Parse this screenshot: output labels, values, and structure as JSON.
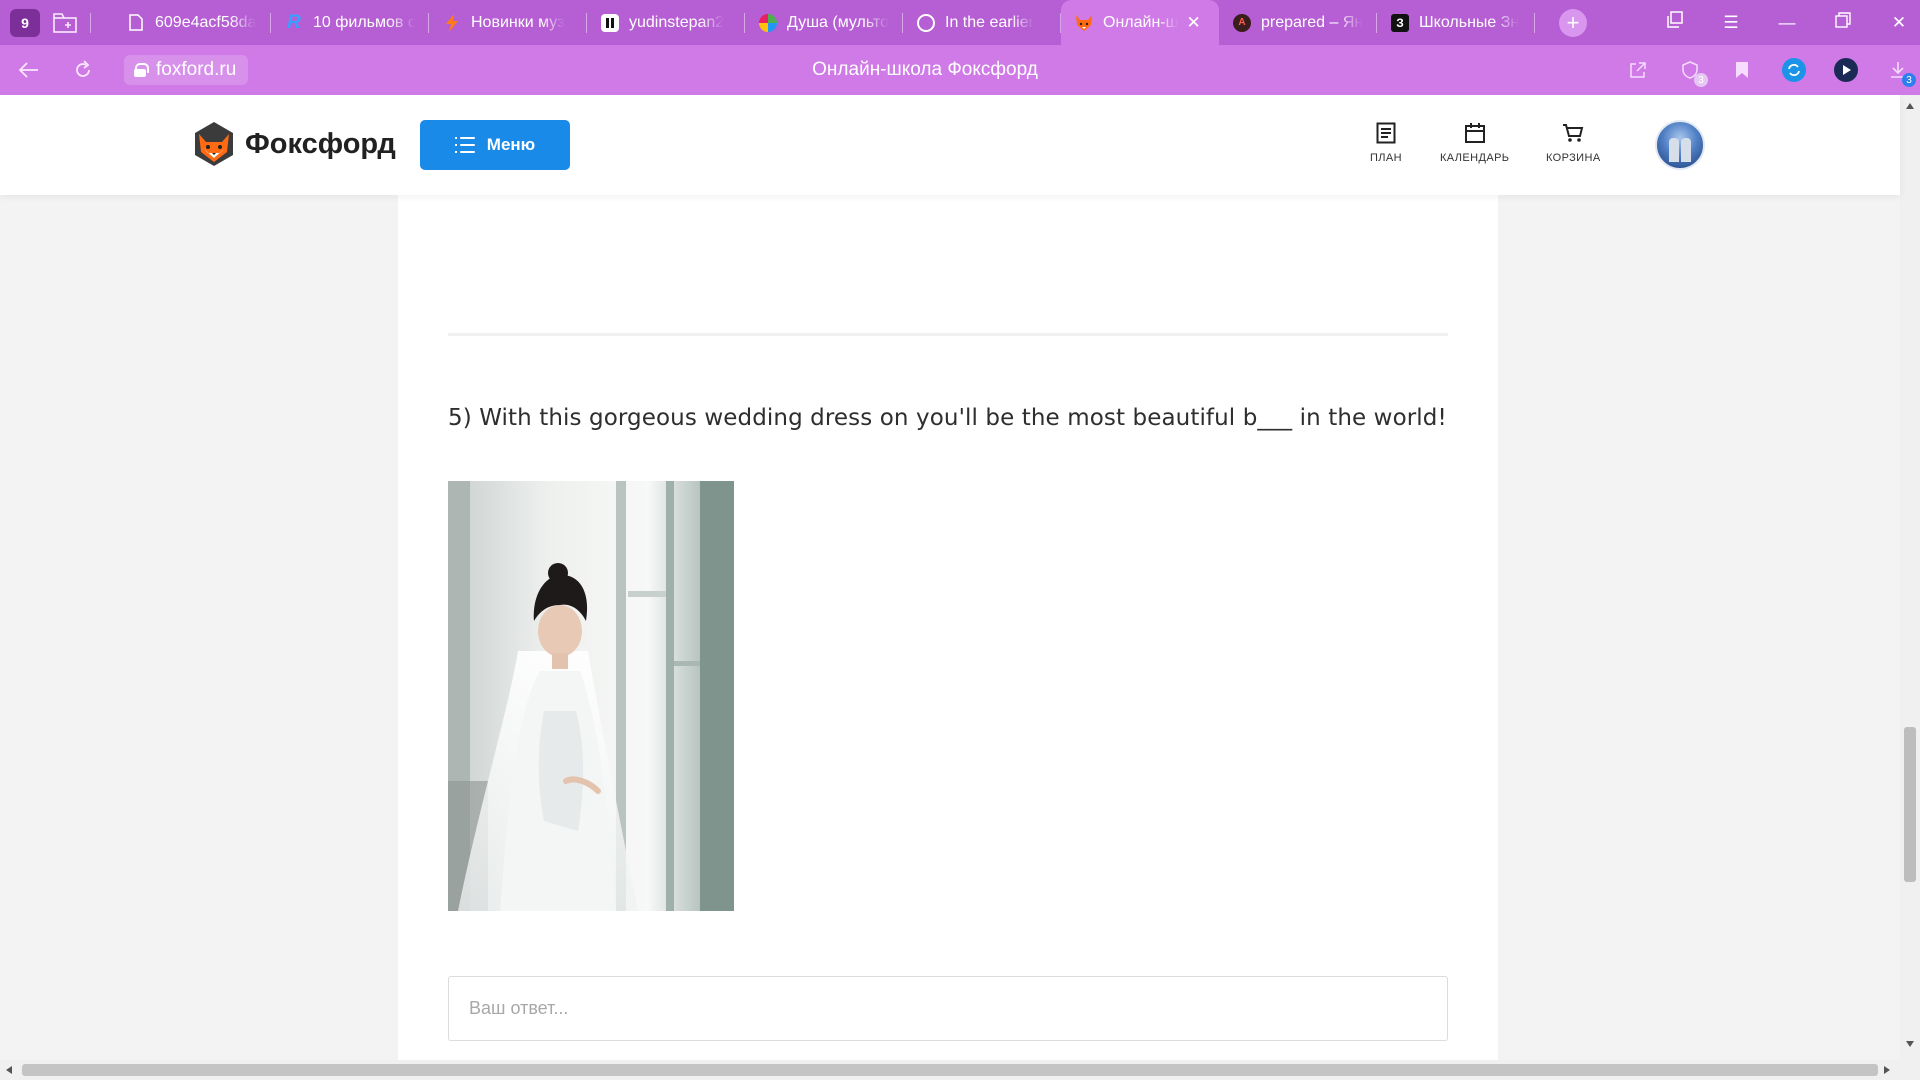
{
  "browser": {
    "tab_count": "9",
    "tabs": [
      {
        "title": "609e4acf58da",
        "favicon": "document-icon",
        "color": "#ffffff"
      },
      {
        "title": "10 фильмов с",
        "favicon": "r-logo-icon",
        "color": "#3aa0ff"
      },
      {
        "title": "Новинки муз",
        "favicon": "lightning-icon",
        "color": "#ff7a1a"
      },
      {
        "title": "yudinstepan2",
        "favicon": "pause-logo-icon",
        "color": "#111111"
      },
      {
        "title": "Душа (мульто",
        "favicon": "globe-icon",
        "color": "#4caf50"
      },
      {
        "title": "In the earlier",
        "favicon": "google-icon",
        "color": "#ffffff"
      },
      {
        "title": "Онлайн-ш",
        "favicon": "fox-icon",
        "color": "#ff6a13",
        "active": true
      },
      {
        "title": "prepared – Ян",
        "favicon": "translate-icon",
        "color": "#e53935"
      },
      {
        "title": "Школьные Зн",
        "favicon": "z-logo-icon",
        "color": "#111111"
      }
    ],
    "address": {
      "domain": "foxford.ru",
      "page_title": "Онлайн-школа Фоксфорд"
    },
    "downloads_badge": "3",
    "ext_badge": "3",
    "accent_color": "#b65ed3"
  },
  "site": {
    "logo_text": "Фоксфорд",
    "menu_label": "Меню",
    "nav": {
      "plan": "ПЛАН",
      "calendar": "КАЛЕНДАРЬ",
      "cart": "КОРЗИНА"
    },
    "brand_color": "#1a8ae8"
  },
  "task": {
    "question": "5) With this gorgeous wedding dress on you'll be the most beautiful b___ in the world!",
    "answer_value": "",
    "answer_placeholder": "Ваш ответ..."
  }
}
